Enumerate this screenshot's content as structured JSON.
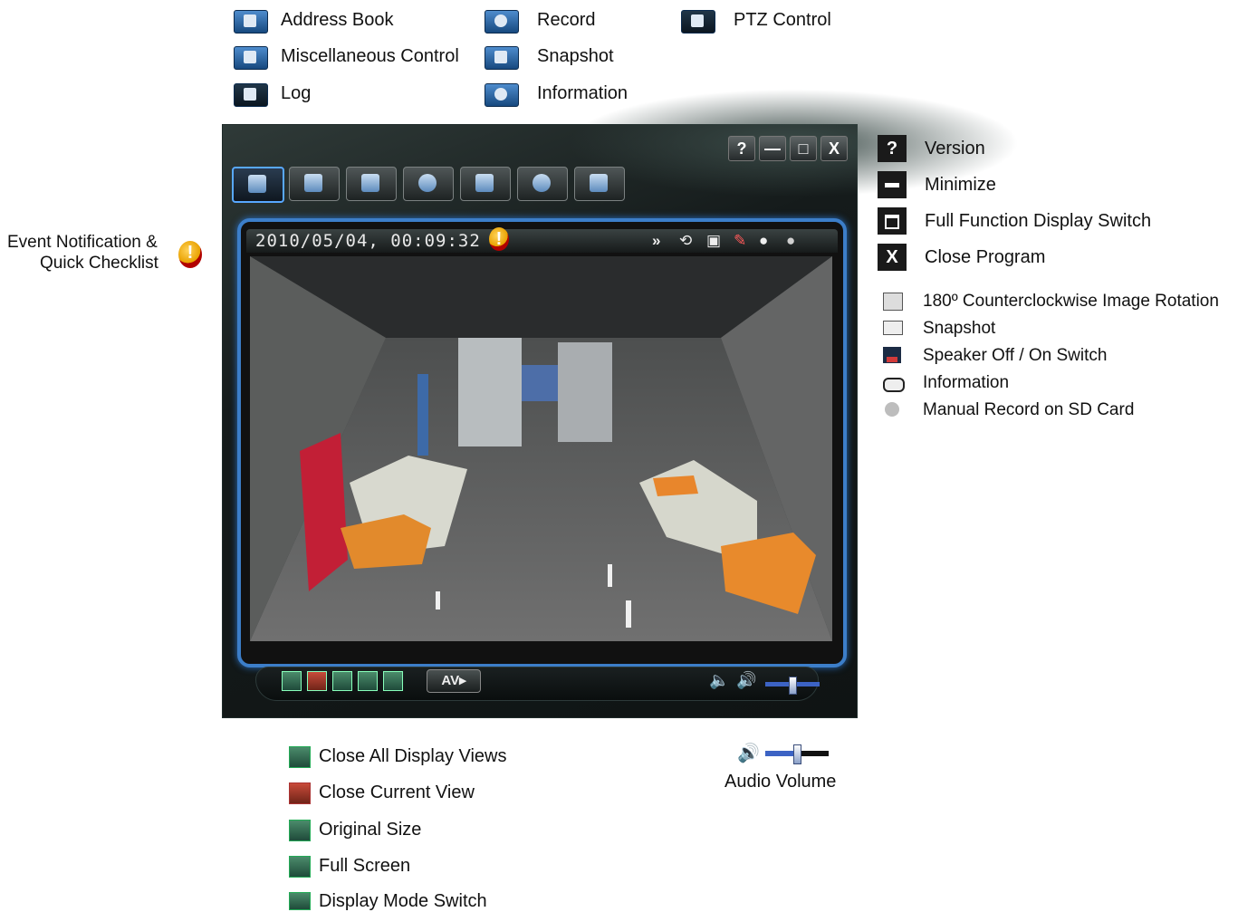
{
  "top_legend": [
    {
      "icon": "address-book-icon",
      "label": "Address Book"
    },
    {
      "icon": "record-icon",
      "label": "Record"
    },
    {
      "icon": "ptz-control-icon",
      "label": "PTZ Control"
    },
    {
      "icon": "misc-control-icon",
      "label": "Miscellaneous Control"
    },
    {
      "icon": "snapshot-icon",
      "label": "Snapshot"
    },
    {
      "icon": "log-icon",
      "label": "Log"
    },
    {
      "icon": "information-icon",
      "label": "Information"
    }
  ],
  "left_annotation": {
    "line1": "Event Notification &",
    "line2": "Quick Checklist"
  },
  "window": {
    "title_buttons": [
      "?",
      "—",
      "□",
      "X"
    ],
    "timestamp": "2010/05/04, 00:09:32",
    "av_label": "AV▸"
  },
  "right_legend": [
    {
      "icon": "version-icon",
      "label": "Version"
    },
    {
      "icon": "minimize-icon",
      "label": "Minimize"
    },
    {
      "icon": "full-function-display-icon",
      "label": "Full Function Display Switch"
    },
    {
      "icon": "close-program-icon",
      "label": "Close Program"
    }
  ],
  "right_small_legend": [
    {
      "icon": "rotate-icon",
      "label": "180º Counterclockwise Image Rotation"
    },
    {
      "icon": "snapshot-small-icon",
      "label": "Snapshot"
    },
    {
      "icon": "speaker-icon",
      "label": "Speaker Off / On Switch"
    },
    {
      "icon": "information-bubble-icon",
      "label": "Information"
    },
    {
      "icon": "manual-record-icon",
      "label": "Manual Record on SD Card"
    }
  ],
  "bottom_legend": [
    {
      "icon": "close-all-views-icon",
      "label": "Close All Display Views"
    },
    {
      "icon": "close-current-view-icon",
      "label": "Close Current View"
    },
    {
      "icon": "original-size-icon",
      "label": "Original Size"
    },
    {
      "icon": "full-screen-icon",
      "label": "Full Screen"
    },
    {
      "icon": "display-mode-switch-icon",
      "label": "Display Mode Switch"
    }
  ],
  "audio": {
    "label": "Audio Volume",
    "level_fraction": 0.5
  },
  "colors": {
    "accent_blue": "#3c7ec9",
    "window_bg": "#151b1b",
    "warning": "#e9a100"
  }
}
